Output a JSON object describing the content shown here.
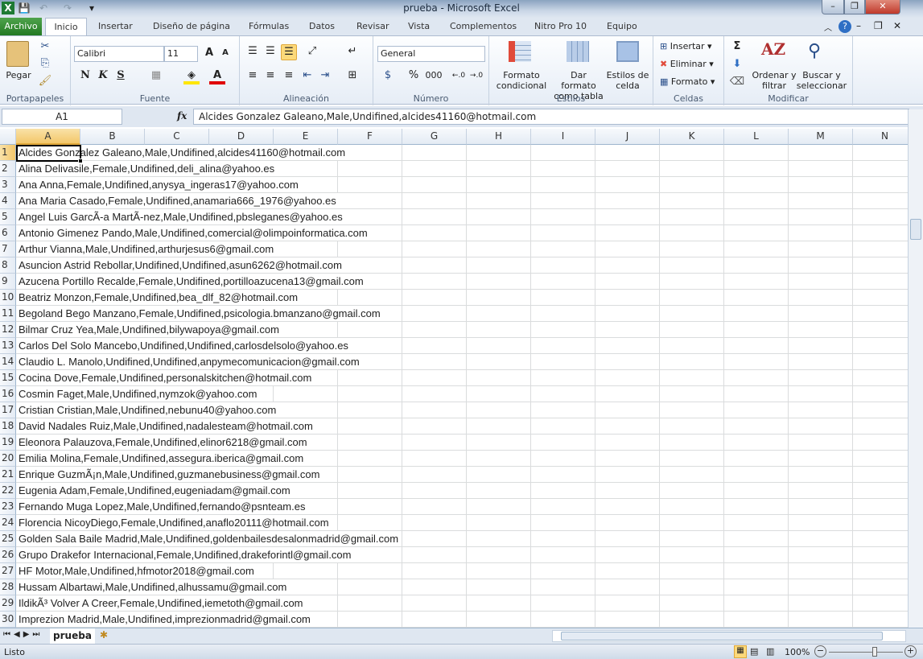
{
  "window": {
    "title": "prueba  -  Microsoft Excel",
    "minimize": "–",
    "restore": "❐",
    "close": "✕"
  },
  "tabs": [
    {
      "label": "Archivo"
    },
    {
      "label": "Inicio"
    },
    {
      "label": "Insertar"
    },
    {
      "label": "Diseño de página"
    },
    {
      "label": "Fórmulas"
    },
    {
      "label": "Datos"
    },
    {
      "label": "Revisar"
    },
    {
      "label": "Vista"
    },
    {
      "label": "Complementos"
    },
    {
      "label": "Nitro Pro 10"
    },
    {
      "label": "Equipo"
    }
  ],
  "ribbon": {
    "clipboard": {
      "label": "Portapapeles",
      "paste": "Pegar"
    },
    "font": {
      "label": "Fuente",
      "name": "Calibri",
      "size": "11",
      "bold": "N",
      "italic": "K",
      "underline": "S"
    },
    "alignment": {
      "label": "Alineación"
    },
    "number": {
      "label": "Número",
      "format": "General",
      "percent": "%",
      "thousands": "000"
    },
    "styles": {
      "label": "Estilos",
      "conditional": "Formato condicional",
      "table": "Dar formato como tabla",
      "cell": "Estilos de celda"
    },
    "cells": {
      "label": "Celdas",
      "insert": "Insertar",
      "delete": "Eliminar",
      "format": "Formato"
    },
    "editing": {
      "label": "Modificar",
      "sort": "Ordenar y filtrar",
      "find": "Buscar y seleccionar",
      "sum": "Σ"
    }
  },
  "formula_bar": {
    "name_box": "A1",
    "fx": "fx",
    "value": "Alcides Gonzalez Galeano,Male,Undifined,alcides41160@hotmail.com"
  },
  "columns": [
    "A",
    "B",
    "C",
    "D",
    "E",
    "F",
    "G",
    "H",
    "I",
    "J",
    "K",
    "L",
    "M",
    "N"
  ],
  "rows": [
    "Alcides Gonzalez Galeano,Male,Undifined,alcides41160@hotmail.com",
    "Alina Delivasile,Female,Undifined,deli_alina@yahoo.es",
    "Ana Anna,Female,Undifined,anysya_ingeras17@yahoo.com",
    "Ana Maria Casado,Female,Undifined,anamaria666_1976@yahoo.es",
    "Angel Luis GarcÃ-a MartÃ-nez,Male,Undifined,pbsleganes@yahoo.es",
    "Antonio Gimenez Pando,Male,Undifined,comercial@olimpoinformatica.com",
    "Arthur Vianna,Male,Undifined,arthurjesus6@gmail.com",
    "Asuncion Astrid Rebollar,Undifined,Undifined,asun6262@hotmail.com",
    "Azucena Portillo Recalde,Female,Undifined,portilloazucena13@gmail.com",
    "Beatriz Monzon,Female,Undifined,bea_dlf_82@hotmail.com",
    "Begoland Bego Manzano,Female,Undifined,psicologia.bmanzano@gmail.com",
    "Bilmar Cruz Yea,Male,Undifined,bilywapoya@gmail.com",
    "Carlos Del Solo Mancebo,Undifined,Undifined,carlosdelsolo@yahoo.es",
    "Claudio L. Manolo,Undifined,Undifined,anpymecomunicacion@gmail.com",
    "Cocina Dove,Female,Undifined,personalskitchen@hotmail.com",
    "Cosmin Faget,Male,Undifined,nymzok@yahoo.com",
    "Cristian Cristian,Male,Undifined,nebunu40@yahoo.com",
    "David Nadales Ruiz,Male,Undifined,nadalesteam@hotmail.com",
    "Eleonora Palauzova,Female,Undifined,elinor6218@gmail.com",
    "Emilia Molina,Female,Undifined,assegura.iberica@gmail.com",
    "Enrique GuzmÃ¡n,Male,Undifined,guzmanebusiness@gmail.com",
    "Eugenia Adam,Female,Undifined,eugeniadam@gmail.com",
    "Fernando Muga Lopez,Male,Undifined,fernando@psnteam.es",
    "Florencia NicoyDiego,Female,Undifined,anaflo20111@hotmail.com",
    "Golden Sala Baile Madrid,Male,Undifined,goldenbailesdesalonmadrid@gmail.com",
    "Grupo Drakefor Internacional,Female,Undifined,drakeforintl@gmail.com",
    "HF Motor,Male,Undifined,hfmotor2018@gmail.com",
    "Hussam Albartawi,Male,Undifined,alhussamu@gmail.com",
    "IldikÃ³ Volver A Creer,Female,Undifined,iemetoth@gmail.com",
    "Imprezion Madrid,Male,Undifined,imprezionmadrid@gmail.com"
  ],
  "sheet_tabs": [
    {
      "label": "prueba"
    }
  ],
  "status": {
    "text": "Listo",
    "zoom": "100%",
    "zoom_level": 100
  },
  "colors": {
    "accent": "#217346",
    "selection": "#000000",
    "archivo": "#2e8b2c"
  }
}
